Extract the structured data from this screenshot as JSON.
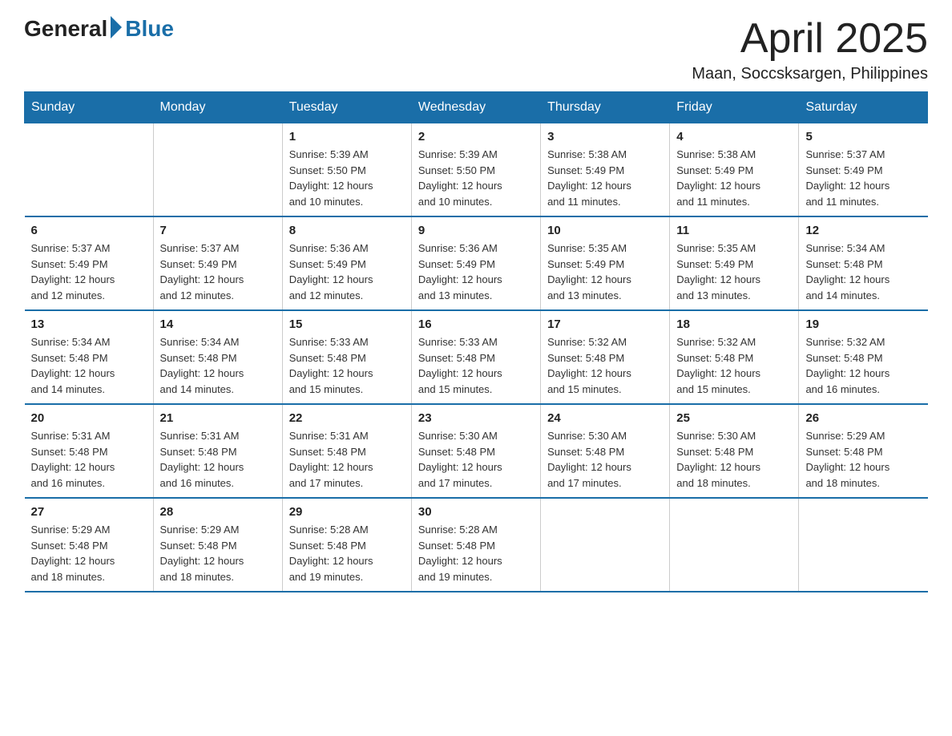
{
  "logo": {
    "general": "General",
    "blue": "Blue"
  },
  "title": "April 2025",
  "subtitle": "Maan, Soccsksargen, Philippines",
  "weekdays": [
    "Sunday",
    "Monday",
    "Tuesday",
    "Wednesday",
    "Thursday",
    "Friday",
    "Saturday"
  ],
  "weeks": [
    [
      {
        "day": "",
        "info": ""
      },
      {
        "day": "",
        "info": ""
      },
      {
        "day": "1",
        "info": "Sunrise: 5:39 AM\nSunset: 5:50 PM\nDaylight: 12 hours\nand 10 minutes."
      },
      {
        "day": "2",
        "info": "Sunrise: 5:39 AM\nSunset: 5:50 PM\nDaylight: 12 hours\nand 10 minutes."
      },
      {
        "day": "3",
        "info": "Sunrise: 5:38 AM\nSunset: 5:49 PM\nDaylight: 12 hours\nand 11 minutes."
      },
      {
        "day": "4",
        "info": "Sunrise: 5:38 AM\nSunset: 5:49 PM\nDaylight: 12 hours\nand 11 minutes."
      },
      {
        "day": "5",
        "info": "Sunrise: 5:37 AM\nSunset: 5:49 PM\nDaylight: 12 hours\nand 11 minutes."
      }
    ],
    [
      {
        "day": "6",
        "info": "Sunrise: 5:37 AM\nSunset: 5:49 PM\nDaylight: 12 hours\nand 12 minutes."
      },
      {
        "day": "7",
        "info": "Sunrise: 5:37 AM\nSunset: 5:49 PM\nDaylight: 12 hours\nand 12 minutes."
      },
      {
        "day": "8",
        "info": "Sunrise: 5:36 AM\nSunset: 5:49 PM\nDaylight: 12 hours\nand 12 minutes."
      },
      {
        "day": "9",
        "info": "Sunrise: 5:36 AM\nSunset: 5:49 PM\nDaylight: 12 hours\nand 13 minutes."
      },
      {
        "day": "10",
        "info": "Sunrise: 5:35 AM\nSunset: 5:49 PM\nDaylight: 12 hours\nand 13 minutes."
      },
      {
        "day": "11",
        "info": "Sunrise: 5:35 AM\nSunset: 5:49 PM\nDaylight: 12 hours\nand 13 minutes."
      },
      {
        "day": "12",
        "info": "Sunrise: 5:34 AM\nSunset: 5:48 PM\nDaylight: 12 hours\nand 14 minutes."
      }
    ],
    [
      {
        "day": "13",
        "info": "Sunrise: 5:34 AM\nSunset: 5:48 PM\nDaylight: 12 hours\nand 14 minutes."
      },
      {
        "day": "14",
        "info": "Sunrise: 5:34 AM\nSunset: 5:48 PM\nDaylight: 12 hours\nand 14 minutes."
      },
      {
        "day": "15",
        "info": "Sunrise: 5:33 AM\nSunset: 5:48 PM\nDaylight: 12 hours\nand 15 minutes."
      },
      {
        "day": "16",
        "info": "Sunrise: 5:33 AM\nSunset: 5:48 PM\nDaylight: 12 hours\nand 15 minutes."
      },
      {
        "day": "17",
        "info": "Sunrise: 5:32 AM\nSunset: 5:48 PM\nDaylight: 12 hours\nand 15 minutes."
      },
      {
        "day": "18",
        "info": "Sunrise: 5:32 AM\nSunset: 5:48 PM\nDaylight: 12 hours\nand 15 minutes."
      },
      {
        "day": "19",
        "info": "Sunrise: 5:32 AM\nSunset: 5:48 PM\nDaylight: 12 hours\nand 16 minutes."
      }
    ],
    [
      {
        "day": "20",
        "info": "Sunrise: 5:31 AM\nSunset: 5:48 PM\nDaylight: 12 hours\nand 16 minutes."
      },
      {
        "day": "21",
        "info": "Sunrise: 5:31 AM\nSunset: 5:48 PM\nDaylight: 12 hours\nand 16 minutes."
      },
      {
        "day": "22",
        "info": "Sunrise: 5:31 AM\nSunset: 5:48 PM\nDaylight: 12 hours\nand 17 minutes."
      },
      {
        "day": "23",
        "info": "Sunrise: 5:30 AM\nSunset: 5:48 PM\nDaylight: 12 hours\nand 17 minutes."
      },
      {
        "day": "24",
        "info": "Sunrise: 5:30 AM\nSunset: 5:48 PM\nDaylight: 12 hours\nand 17 minutes."
      },
      {
        "day": "25",
        "info": "Sunrise: 5:30 AM\nSunset: 5:48 PM\nDaylight: 12 hours\nand 18 minutes."
      },
      {
        "day": "26",
        "info": "Sunrise: 5:29 AM\nSunset: 5:48 PM\nDaylight: 12 hours\nand 18 minutes."
      }
    ],
    [
      {
        "day": "27",
        "info": "Sunrise: 5:29 AM\nSunset: 5:48 PM\nDaylight: 12 hours\nand 18 minutes."
      },
      {
        "day": "28",
        "info": "Sunrise: 5:29 AM\nSunset: 5:48 PM\nDaylight: 12 hours\nand 18 minutes."
      },
      {
        "day": "29",
        "info": "Sunrise: 5:28 AM\nSunset: 5:48 PM\nDaylight: 12 hours\nand 19 minutes."
      },
      {
        "day": "30",
        "info": "Sunrise: 5:28 AM\nSunset: 5:48 PM\nDaylight: 12 hours\nand 19 minutes."
      },
      {
        "day": "",
        "info": ""
      },
      {
        "day": "",
        "info": ""
      },
      {
        "day": "",
        "info": ""
      }
    ]
  ]
}
